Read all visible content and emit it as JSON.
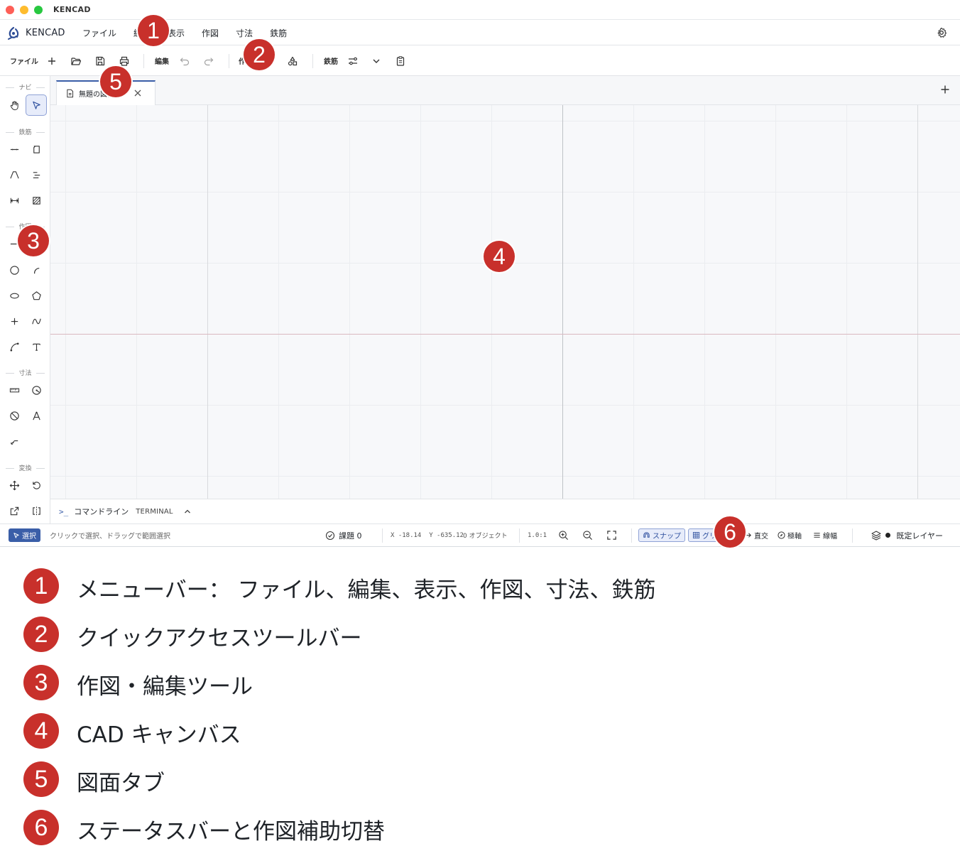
{
  "window": {
    "title": "KENCAD"
  },
  "menubar": {
    "brand": "KENCAD",
    "items": [
      "ファイル",
      "編集",
      "表示",
      "作図",
      "寸法",
      "鉄筋"
    ]
  },
  "toolbar": {
    "file_label": "ファイル",
    "edit_label": "編集",
    "draw_label": "作図",
    "rebar_label": "鉄筋"
  },
  "toolpanel": {
    "sections": [
      "ナビ",
      "鉄筋",
      "作図",
      "寸法",
      "変換"
    ]
  },
  "tabs": {
    "active": "無題の図面"
  },
  "commandline": {
    "prompt": ">_",
    "title": "コマンドライン",
    "terminal": "TERMINAL"
  },
  "statusbar": {
    "mode": "選択",
    "hint": "クリックで選択、ドラッグで範囲選択",
    "issues": "課題 0",
    "x_label": "X",
    "x_value": "-18.14",
    "y_label": "Y",
    "y_value": "-635.12",
    "objects": "0 オブジェクト",
    "scale": "1.0:1",
    "snap": "スナップ",
    "grid": "グリッド",
    "ortho": "直交",
    "polar": "極軸",
    "lineweight": "線幅",
    "layer": "既定レイヤー"
  },
  "callouts": [
    "1",
    "2",
    "3",
    "4",
    "5",
    "6"
  ],
  "legend": [
    {
      "num": "1",
      "text": "メニューバー： ファイル、編集、表示、作図、寸法、鉄筋"
    },
    {
      "num": "2",
      "text": "クイックアクセスツールバー"
    },
    {
      "num": "3",
      "text": "作図・編集ツール"
    },
    {
      "num": "4",
      "text": "CAD キャンバス"
    },
    {
      "num": "5",
      "text": "図面タブ"
    },
    {
      "num": "6",
      "text": "ステータスバーと作図補助切替"
    }
  ],
  "colors": {
    "accent": "#3a5ea8",
    "callout": "#c8302b",
    "canvas_bg": "#f7f8fa"
  }
}
